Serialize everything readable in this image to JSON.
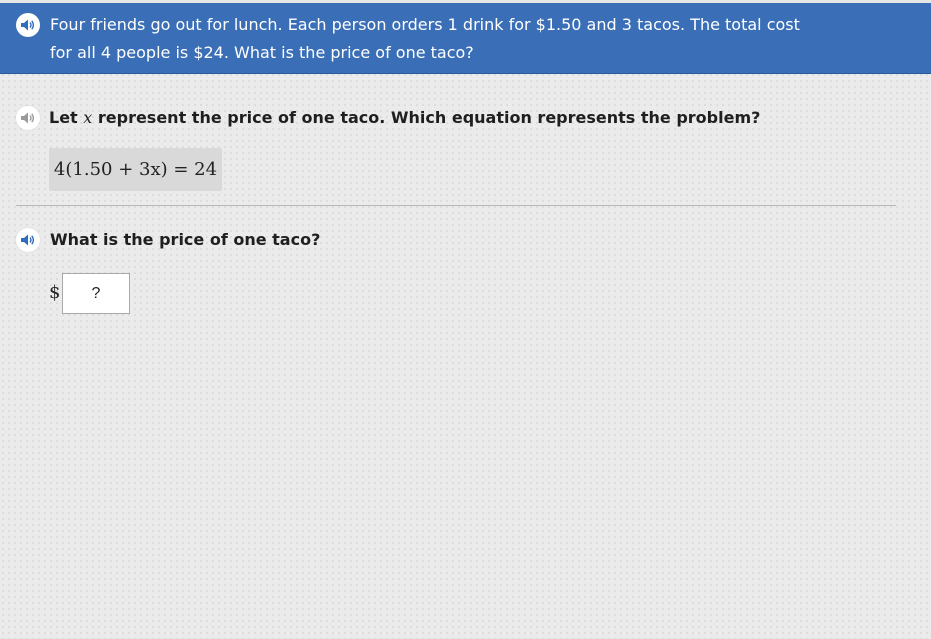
{
  "banner": {
    "speaker_icon": "speaker-icon",
    "text": "Four friends go out for lunch. Each person orders 1 drink for $1.50 and 3 tacos. The total cost for all 4 people is $24. What is the price of one taco?",
    "bg_color": "#3a6fb7"
  },
  "part1": {
    "speaker_icon": "speaker-icon",
    "prompt_before": "Let ",
    "prompt_var": "x",
    "prompt_after": " represent the price of one taco. Which equation represents the problem?",
    "answer": "4(1.50 + 3x) = 24"
  },
  "part2": {
    "speaker_icon": "speaker-icon",
    "prompt": "What is the price of one taco?",
    "currency": "$",
    "input_value": "?"
  },
  "colors": {
    "speaker_active": "#2f6dbf",
    "speaker_inactive": "#9a9a9a"
  }
}
